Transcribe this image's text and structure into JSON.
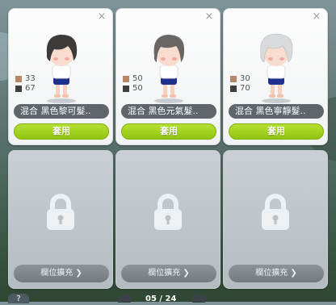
{
  "slots": [
    {
      "type": "unlocked",
      "hair_color": "#3d3b39",
      "stat1": "33",
      "stat2": "67",
      "stat1_color": "#b98668",
      "stat2_color": "#3f3f3f",
      "name": "混合 黑色黎可髮..",
      "apply_label": "套用"
    },
    {
      "type": "unlocked",
      "hair_color": "#6a6664",
      "stat1": "50",
      "stat2": "50",
      "stat1_color": "#b98668",
      "stat2_color": "#3f3f3f",
      "name": "混合 黑色元氣髮..",
      "apply_label": "套用"
    },
    {
      "type": "unlocked",
      "hair_color": "#d8dadc",
      "stat1": "30",
      "stat2": "70",
      "stat1_color": "#b98668",
      "stat2_color": "#3f3f3f",
      "name": "混合 黑色寧靜髮..",
      "apply_label": "套用"
    },
    {
      "type": "locked",
      "expand_label": "欄位擴充"
    },
    {
      "type": "locked",
      "expand_label": "欄位擴充"
    },
    {
      "type": "locked",
      "expand_label": "欄位擴充"
    }
  ],
  "help_label": "?",
  "pager": {
    "text": "05 / 24"
  }
}
